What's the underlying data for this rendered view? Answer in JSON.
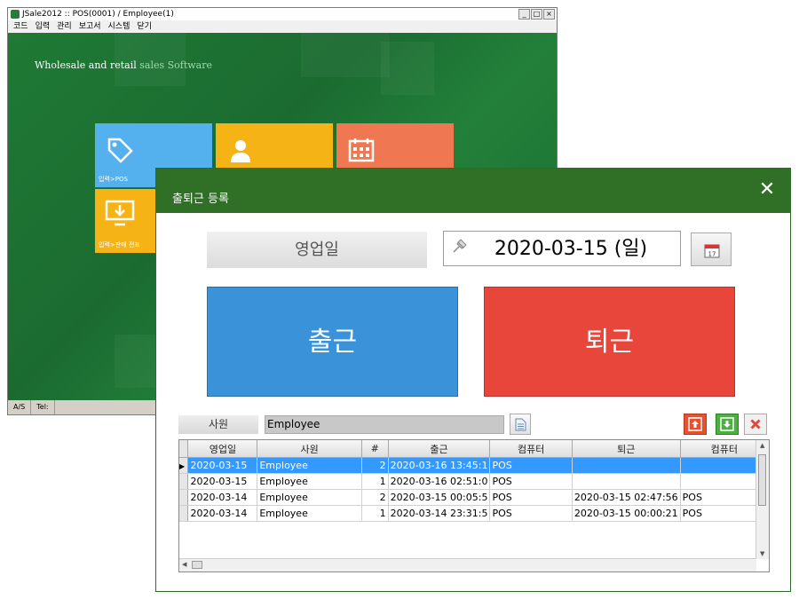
{
  "main_window": {
    "title": "JSale2012  ::  POS(0001) / Employee(1)",
    "window_buttons": [
      "_",
      "□",
      "×"
    ],
    "menu": [
      "코드",
      "입력",
      "관리",
      "보고서",
      "시스템",
      "닫기"
    ],
    "tagline_bright": "Wholesale and retail ",
    "tagline_dim": "sales Software",
    "tiles": [
      {
        "label": "입력>POS",
        "color": "#55b1ee",
        "icon": "tag-icon"
      },
      {
        "label": "",
        "color": "#f6b316",
        "icon": "person-icon"
      },
      {
        "label": "",
        "color": "#ef7752",
        "icon": "calendar-icon"
      },
      {
        "label": "입력>판매 전표",
        "color": "#f6b316",
        "icon": "monitor-download-icon"
      }
    ],
    "status": [
      "A/S",
      "Tel:"
    ]
  },
  "dialog": {
    "title": "출퇴근 등록",
    "date_label": "영업일",
    "date_value": "2020-03-15 (일)",
    "checkin_label": "출근",
    "checkout_label": "퇴근",
    "employee_label": "사원",
    "employee_value": "Employee",
    "colors": {
      "header": "#2f6f26",
      "checkin": "#3a92d8",
      "checkout": "#e8463b",
      "selection": "#3399ff"
    }
  },
  "grid": {
    "columns": [
      "영업일",
      "사원",
      "#",
      "출근",
      "컴퓨터",
      "퇴근",
      "컴퓨터"
    ],
    "rows": [
      [
        "2020-03-15",
        "Employee",
        "2",
        "2020-03-16 13:45:1",
        "POS",
        "",
        ""
      ],
      [
        "2020-03-15",
        "Employee",
        "1",
        "2020-03-16 02:51:0",
        "POS",
        "",
        ""
      ],
      [
        "2020-03-14",
        "Employee",
        "2",
        "2020-03-15 00:05:5",
        "POS",
        "2020-03-15 02:47:56",
        "POS"
      ],
      [
        "2020-03-14",
        "Employee",
        "1",
        "2020-03-14 23:31:5",
        "POS",
        "2020-03-15 00:00:21",
        "POS"
      ]
    ],
    "selected_row": 0
  }
}
